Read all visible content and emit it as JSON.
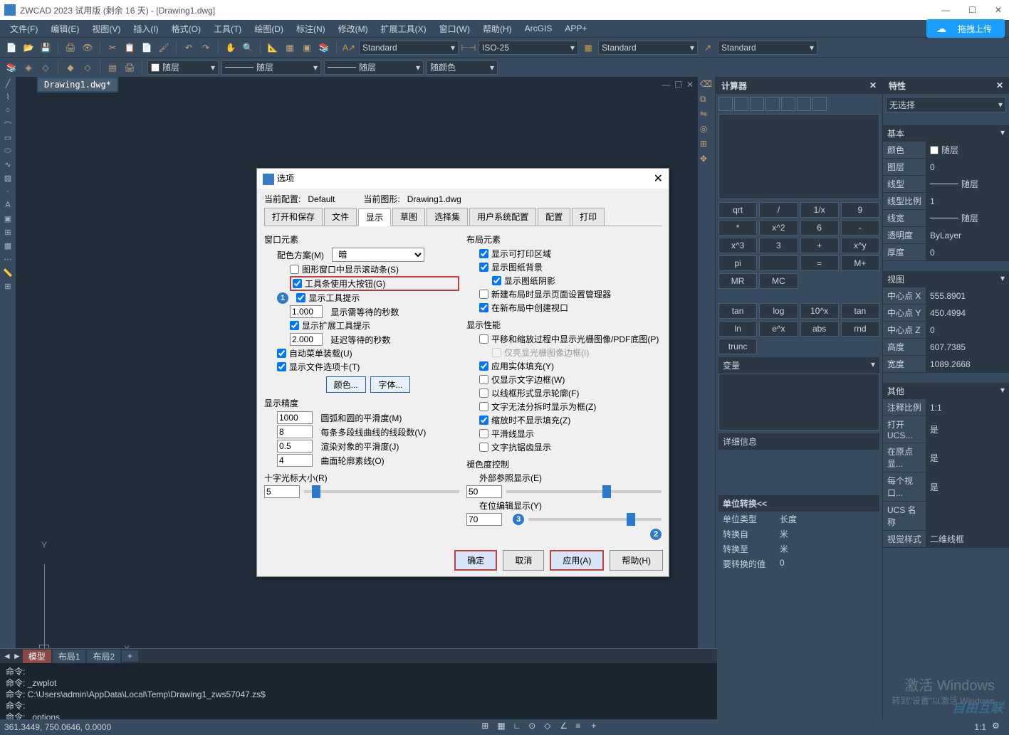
{
  "title": "ZWCAD 2023 试用版 (剩余 16 天) - [Drawing1.dwg]",
  "menu": [
    "文件(F)",
    "编辑(E)",
    "视图(V)",
    "插入(I)",
    "格式(O)",
    "工具(T)",
    "绘图(D)",
    "标注(N)",
    "修改(M)",
    "扩展工具(X)",
    "窗口(W)",
    "帮助(H)",
    "ArcGIS",
    "APP+"
  ],
  "upload_label": "拖拽上传",
  "toolbar2": {
    "layer": "随层",
    "style1": "Standard",
    "iso": "ISO-25",
    "style2": "Standard",
    "style3": "Standard",
    "color": "随层",
    "lt": "随层",
    "color2": "随颜色"
  },
  "doc_tab": "Drawing1.dwg*",
  "calc": {
    "title": "计算器",
    "grid": [
      [
        "qrt",
        "/",
        "1/x"
      ],
      [
        "9",
        "*",
        "x^2"
      ],
      [
        "6",
        "-",
        "x^3"
      ],
      [
        "3",
        "+",
        "x^y"
      ],
      [
        "pi",
        "",
        "="
      ],
      [
        "M+",
        "MR",
        "MC"
      ],
      [
        "tan",
        "log",
        "10^x"
      ],
      [
        "tan",
        "ln",
        "e^x"
      ],
      [
        "abs",
        "rnd",
        "trunc"
      ]
    ],
    "var_hdr": "变量",
    "detail_hdr": "详细信息",
    "unit_hdr": "单位转换<<",
    "unit_rows": [
      [
        "单位类型",
        "长度"
      ],
      [
        "转换自",
        "米"
      ],
      [
        "转换至",
        "米"
      ],
      [
        "要转换的值",
        "0"
      ]
    ]
  },
  "props": {
    "title": "特性",
    "sel": "无选择",
    "sect_basic": "基本",
    "basic": [
      [
        "颜色",
        "随层"
      ],
      [
        "图层",
        "0"
      ],
      [
        "线型",
        "随层"
      ],
      [
        "线型比例",
        "1"
      ],
      [
        "线宽",
        "随层"
      ],
      [
        "透明度",
        "ByLayer"
      ],
      [
        "厚度",
        "0"
      ]
    ],
    "sect_view": "视图",
    "view": [
      [
        "中心点 X",
        "555.8901"
      ],
      [
        "中心点 Y",
        "450.4994"
      ],
      [
        "中心点 Z",
        "0"
      ],
      [
        "高度",
        "607.7385"
      ],
      [
        "宽度",
        "1089.2668"
      ]
    ],
    "sect_other": "其他",
    "other": [
      [
        "注释比例",
        "1:1"
      ],
      [
        "打开 UCS...",
        "是"
      ],
      [
        "在原点显...",
        "是"
      ],
      [
        "每个视口...",
        "是"
      ],
      [
        "UCS 名称",
        ""
      ],
      [
        "视觉样式",
        "二维线框"
      ]
    ]
  },
  "cmd": {
    "tabs": [
      "模型",
      "布局1",
      "布局2"
    ],
    "lines": [
      "命令:",
      "命令: _zwplot",
      "命令: C:\\Users\\admin\\AppData\\Local\\Temp\\Drawing1_zws57047.zs$",
      "命令:",
      "命令: _options"
    ]
  },
  "status": "361.3449, 750.0646, 0.0000",
  "status_right": "1:1",
  "watermark": {
    "l1": "激活 Windows",
    "l2": "转到\"设置\"以激活 Windows"
  },
  "brand": "自由互联",
  "dlg": {
    "title": "选项",
    "profile_lbl": "当前配置:",
    "profile": "Default",
    "drawing_lbl": "当前图形:",
    "drawing": "Drawing1.dwg",
    "tabs": [
      "打开和保存",
      "文件",
      "显示",
      "草图",
      "选择集",
      "用户系统配置",
      "配置",
      "打印"
    ],
    "left": {
      "window_elem": "窗口元素",
      "scheme_lbl": "配色方案(M)",
      "scheme": "暗",
      "cb_scroll": "图形窗口中显示滚动条(S)",
      "cb_bigbtn": "工具条使用大按钮(G)",
      "cb_tooltip": "显示工具提示",
      "tip_sec1": "1.000",
      "tip_sec1_lbl": "显示需等待的秒数",
      "cb_ext_tip": "显示扩展工具提示",
      "tip_sec2": "2.000",
      "tip_sec2_lbl": "延迟等待的秒数",
      "cb_automenu": "自动菜单装载(U)",
      "cb_filetab": "显示文件选项卡(T)",
      "btn_color": "颜色...",
      "btn_font": "字体...",
      "precision": "显示精度",
      "prec1": "1000",
      "prec1_lbl": "圆弧和圆的平滑度(M)",
      "prec2": "8",
      "prec2_lbl": "每条多段线曲线的线段数(V)",
      "prec3": "0.5",
      "prec3_lbl": "渲染对象的平滑度(J)",
      "prec4": "4",
      "prec4_lbl": "曲面轮廓素线(O)",
      "cross_lbl": "十字光标大小(R)",
      "cross": "5"
    },
    "right": {
      "layout": "布局元素",
      "cb_print": "显示可打印区域",
      "cb_bg": "显示图纸背景",
      "cb_shadow": "显示图纸阴影",
      "cb_newlayout": "新建布局时显示页面设置管理器",
      "cb_viewport": "在新布局中创建视口",
      "perf": "显示性能",
      "cb_pan": "平移和缩放过程中显示光栅图像/PDF底图(P)",
      "cb_border": "仅亮显光栅图像边框(I)",
      "cb_fill": "应用实体填充(Y)",
      "cb_textframe": "仅显示文字边框(W)",
      "cb_wire": "以线框形式显示轮廓(F)",
      "cb_nosplit": "文字无法分拆时显示为框(Z)",
      "cb_nofill": "缩放时不显示填充(Z)",
      "cb_smooth": "平滑线显示",
      "cb_aa": "文字抗锯齿显示",
      "fade": "褪色度控制",
      "xref_lbl": "外部参照显示(E)",
      "xref": "50",
      "edit_lbl": "在位编辑显示(Y)",
      "edit": "70"
    },
    "btns": {
      "ok": "确定",
      "cancel": "取消",
      "apply": "应用(A)",
      "help": "帮助(H)"
    }
  }
}
